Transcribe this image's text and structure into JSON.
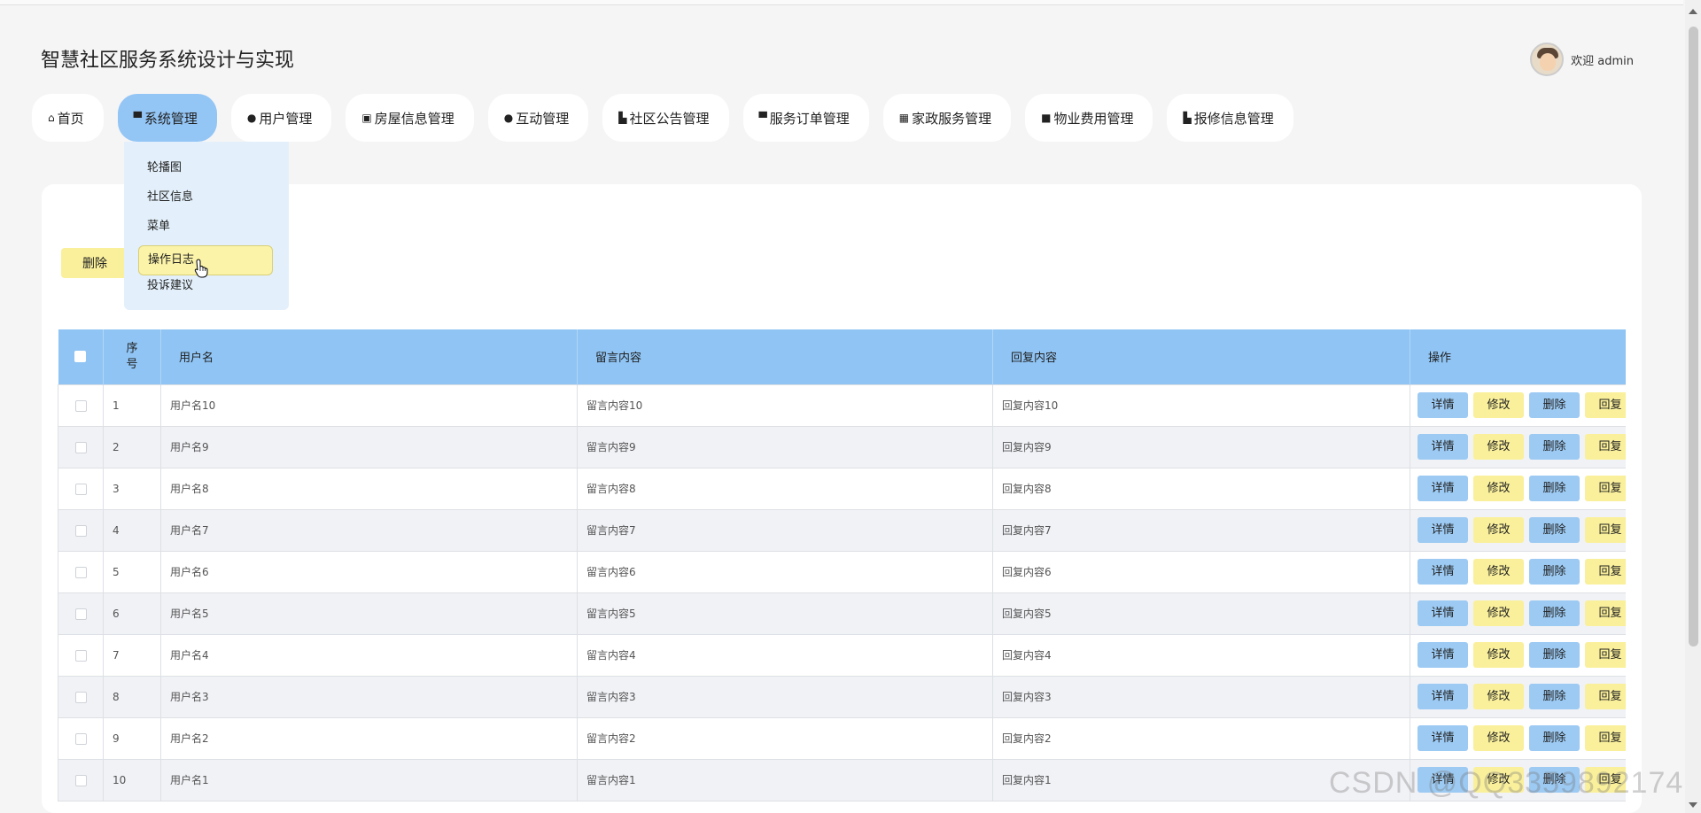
{
  "app": {
    "title": "智慧社区服务系统设计与实现"
  },
  "user": {
    "greeting": "欢迎 admin"
  },
  "nav": [
    {
      "label": "首页",
      "icon": "home-icon",
      "glyph": "⌂"
    },
    {
      "label": "系统管理",
      "icon": "window-icon",
      "glyph": "▀"
    },
    {
      "label": "用户管理",
      "icon": "user-icon",
      "glyph": "●"
    },
    {
      "label": "房屋信息管理",
      "icon": "card-icon",
      "glyph": "▣"
    },
    {
      "label": "互动管理",
      "icon": "drop-icon",
      "glyph": "●"
    },
    {
      "label": "社区公告管理",
      "icon": "bank-icon",
      "glyph": "▙"
    },
    {
      "label": "服务订单管理",
      "icon": "window-icon",
      "glyph": "▀"
    },
    {
      "label": "家政服务管理",
      "icon": "store-icon",
      "glyph": "▦"
    },
    {
      "label": "物业费用管理",
      "icon": "book-icon",
      "glyph": "■"
    },
    {
      "label": "报修信息管理",
      "icon": "bank-icon",
      "glyph": "▙"
    }
  ],
  "dropdown": [
    "轮播图",
    "社区信息",
    "菜单",
    "操作日志",
    "投诉建议"
  ],
  "toolbar": {
    "delete_label": "删除"
  },
  "table": {
    "headers": {
      "seq": "序\n号",
      "username": "用户名",
      "message": "留言内容",
      "reply": "回复内容",
      "ops": "操作"
    },
    "rows": [
      {
        "seq": "1",
        "username": "用户名10",
        "message": "留言内容10",
        "reply": "回复内容10"
      },
      {
        "seq": "2",
        "username": "用户名9",
        "message": "留言内容9",
        "reply": "回复内容9"
      },
      {
        "seq": "3",
        "username": "用户名8",
        "message": "留言内容8",
        "reply": "回复内容8"
      },
      {
        "seq": "4",
        "username": "用户名7",
        "message": "留言内容7",
        "reply": "回复内容7"
      },
      {
        "seq": "5",
        "username": "用户名6",
        "message": "留言内容6",
        "reply": "回复内容6"
      },
      {
        "seq": "6",
        "username": "用户名5",
        "message": "留言内容5",
        "reply": "回复内容5"
      },
      {
        "seq": "7",
        "username": "用户名4",
        "message": "留言内容4",
        "reply": "回复内容4"
      },
      {
        "seq": "8",
        "username": "用户名3",
        "message": "留言内容3",
        "reply": "回复内容3"
      },
      {
        "seq": "9",
        "username": "用户名2",
        "message": "留言内容2",
        "reply": "回复内容2"
      },
      {
        "seq": "10",
        "username": "用户名1",
        "message": "留言内容1",
        "reply": "回复内容1"
      }
    ],
    "row_actions": [
      "详情",
      "修改",
      "删除",
      "回复"
    ]
  },
  "watermark": "CSDN @QQ3359892174",
  "colors": {
    "accent_blue": "#8fc4f4",
    "accent_yellow": "#faf09b",
    "dropdown_bg": "#e3f0fb"
  }
}
